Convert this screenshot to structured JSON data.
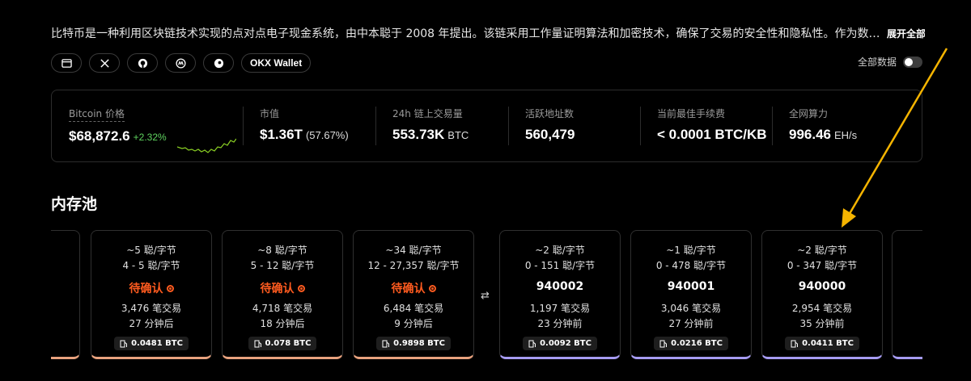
{
  "description": {
    "text": "比特币是一种利用区块链技术实现的点对点电子现金系统，由中本聪于 2008 年提出。该链采用工作量证明算法和加密技术，确保了交易的安全性和隐私性。作为数…",
    "expand_label": "展开全部"
  },
  "links": [
    {
      "icon": "browser-icon"
    },
    {
      "icon": "x-icon"
    },
    {
      "icon": "github-icon"
    },
    {
      "icon": "coinmarketcap-icon"
    },
    {
      "icon": "coingecko-icon"
    },
    {
      "label": "OKX Wallet"
    }
  ],
  "all_data": {
    "label": "全部数据",
    "enabled": false
  },
  "stats": {
    "price": {
      "label": "Bitcoin 价格",
      "value": "$68,872.6",
      "change": "+2.32%"
    },
    "market_cap": {
      "label": "市值",
      "value": "$1.36T",
      "share": "(57.67%)"
    },
    "volume": {
      "label": "24h 链上交易量",
      "value": "553.73K",
      "unit": "BTC"
    },
    "active_addresses": {
      "label": "活跃地址数",
      "value": "560,479"
    },
    "best_fee": {
      "label": "当前最佳手续费",
      "value": "< 0.0001 BTC/KB"
    },
    "hashrate": {
      "label": "全网算力",
      "value": "996.46",
      "unit": "EH/s"
    }
  },
  "mempool": {
    "title": "内存池",
    "blocks": [
      {
        "fee": "~5 聪/字节",
        "range": "4 - 5 聪/字节",
        "status": "待确认",
        "txs": "3,476 笔交易",
        "time": "27 分钟后",
        "reward": "0.0481 BTC",
        "kind": "pending"
      },
      {
        "fee": "~8 聪/字节",
        "range": "5 - 12 聪/字节",
        "status": "待确认",
        "txs": "4,718 笔交易",
        "time": "18 分钟后",
        "reward": "0.078 BTC",
        "kind": "pending"
      },
      {
        "fee": "~34 聪/字节",
        "range": "12 - 27,357 聪/字节",
        "status": "待确认",
        "txs": "6,484 笔交易",
        "time": "9 分钟后",
        "reward": "0.9898 BTC",
        "kind": "pending"
      },
      {
        "fee": "~2 聪/字节",
        "range": "0 - 151 聪/字节",
        "status": "940002",
        "txs": "1,197 笔交易",
        "time": "23 分钟前",
        "reward": "0.0092 BTC",
        "kind": "mined"
      },
      {
        "fee": "~1 聪/字节",
        "range": "0 - 478 聪/字节",
        "status": "940001",
        "txs": "3,046 笔交易",
        "time": "27 分钟前",
        "reward": "0.0216 BTC",
        "kind": "mined"
      },
      {
        "fee": "~2 聪/字节",
        "range": "0 - 347 聪/字节",
        "status": "940000",
        "txs": "2,954 笔交易",
        "time": "35 分钟前",
        "reward": "0.0411 BTC",
        "kind": "mined"
      }
    ],
    "swap_icon": "swap-arrows-icon"
  },
  "colors": {
    "pending": "#e8a27e",
    "mined": "#a69bf2",
    "up": "#5fd35f",
    "status": "#ff5b1f",
    "arrow": "#f5b400"
  }
}
